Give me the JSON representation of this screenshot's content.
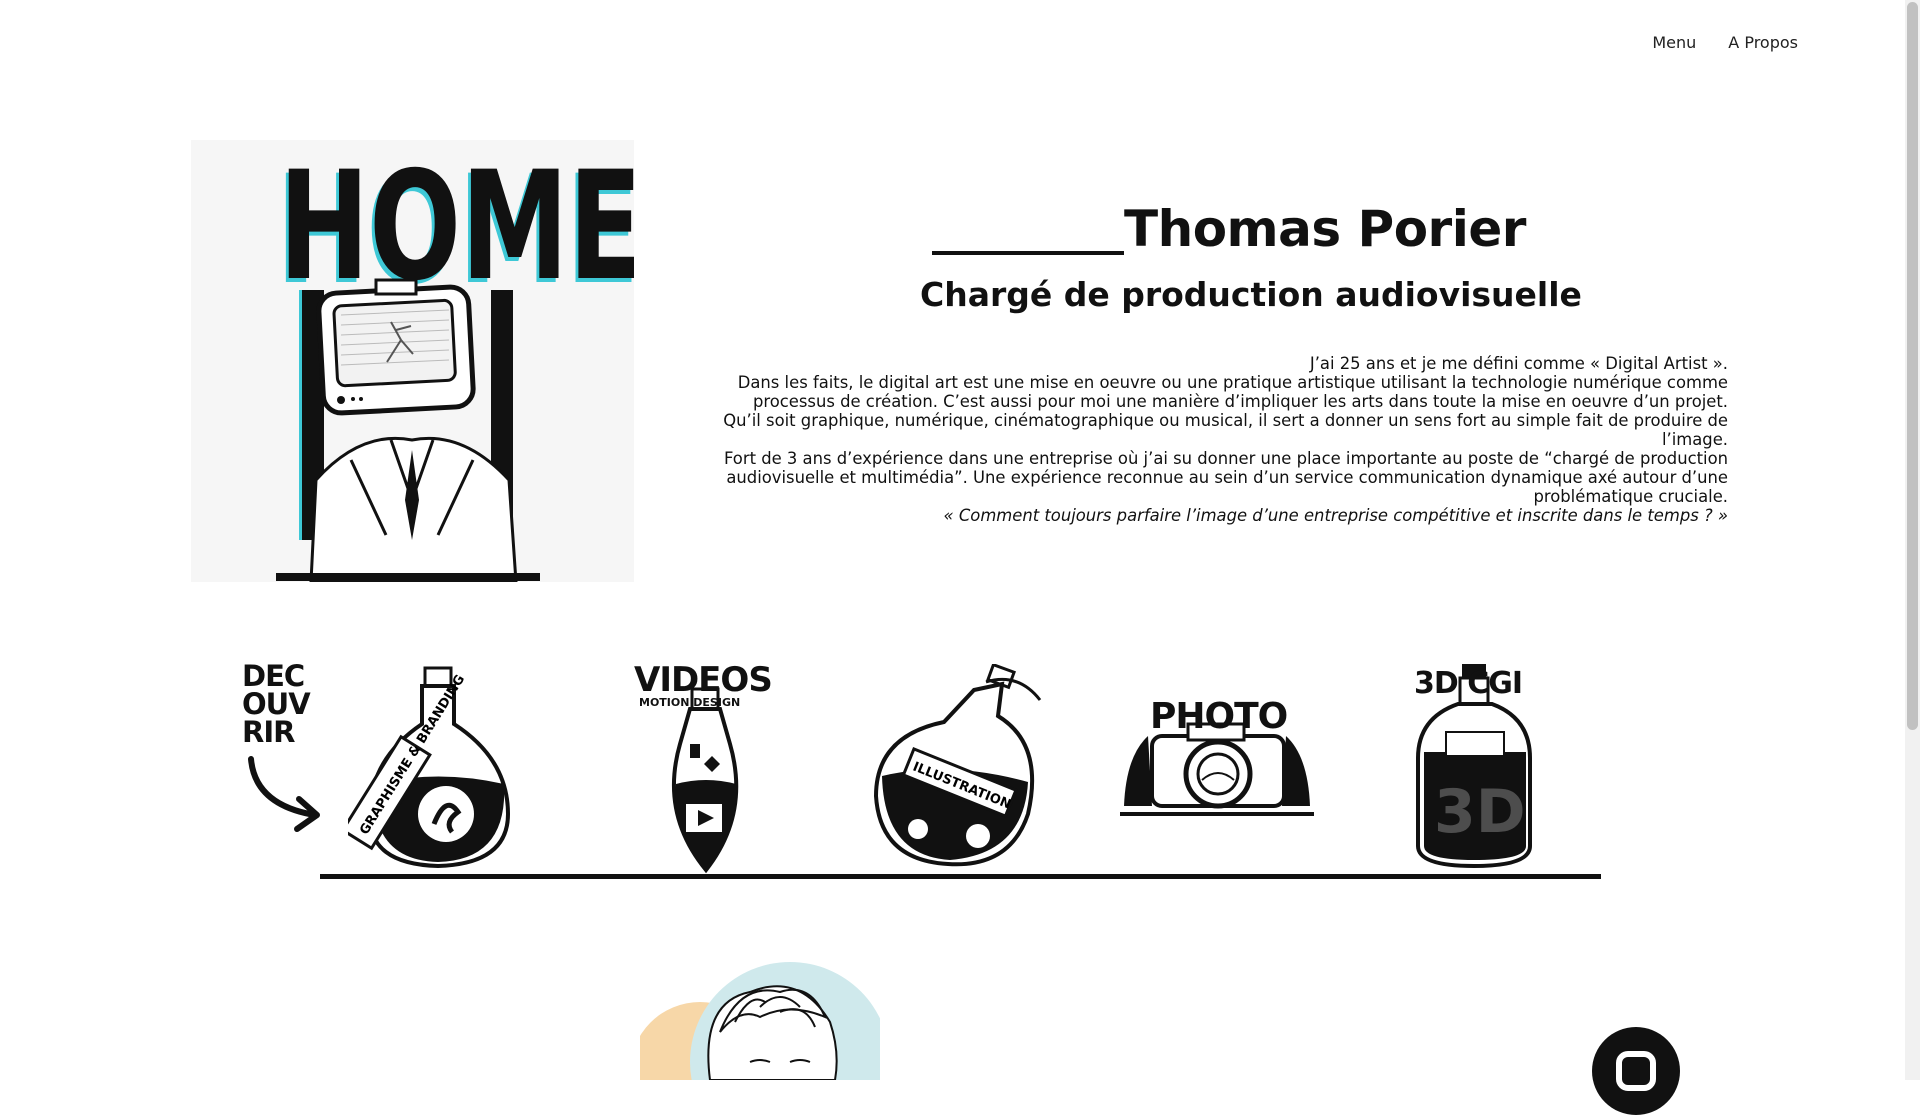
{
  "nav": {
    "menu_label": "Menu",
    "about_label": "A Propos"
  },
  "hero": {
    "image_text": "HOME",
    "name": "Thomas Porier",
    "subtitle": "Chargé de production audiovisuelle",
    "bio": [
      "J’ai 25 ans et je me défini comme « Digital Artist ».",
      "Dans les faits, le digital art est une mise en oeuvre ou une pratique artistique utilisant la technologie numérique comme processus de création. C’est aussi pour moi une manière d’impliquer les arts dans toute la mise en oeuvre d’un projet.",
      "Qu’il soit graphique, numérique, cinématographique ou musical, il sert a donner un sens fort au simple fait de produire de l’image.",
      "Fort de 3 ans d’expérience dans une entreprise où j’ai su donner une place importante au poste de “chargé de production audiovisuelle et multimédia”. Une expérience reconnue au sein d’un service communication dynamique axé autour d’une problématique cruciale."
    ],
    "quote": "« Comment toujours parfaire l’image d’une entreprise compétitive et inscrite dans le temps ? »"
  },
  "discover": {
    "label_lines": [
      "DEC",
      "OUV",
      "RIR"
    ],
    "items": [
      {
        "label": "GRAPHISME & BRANDING",
        "icon": "potion-graphisme-icon"
      },
      {
        "label": "VIDEOS",
        "sublabel": "MOTION DESIGN",
        "icon": "potion-videos-icon"
      },
      {
        "label": "ILLUSTRATION",
        "icon": "potion-illustration-icon"
      },
      {
        "label": "PHOTO",
        "icon": "camera-photo-icon"
      },
      {
        "label": "3D CGI",
        "icon": "bottle-3d-icon"
      }
    ]
  },
  "colors": {
    "accent_cyan": "#3ec8d6",
    "avatar_peach": "#f7d7a8",
    "avatar_teal": "#cfe9ec",
    "ink": "#111111"
  }
}
